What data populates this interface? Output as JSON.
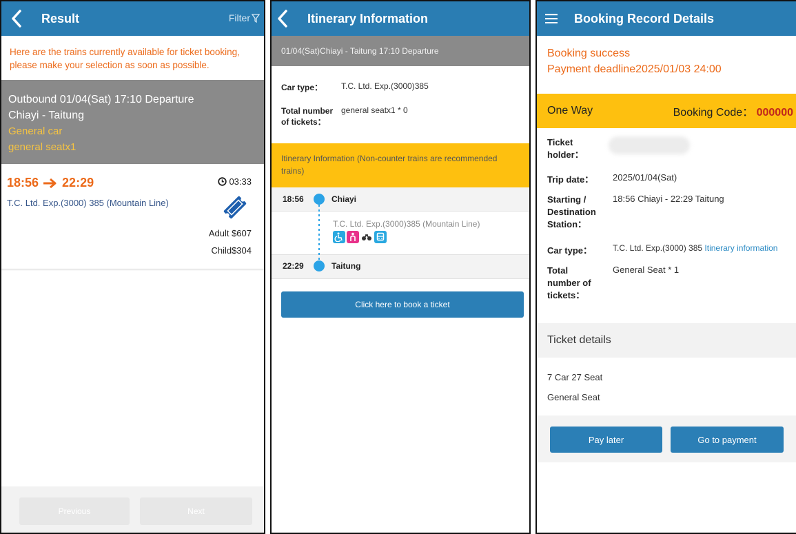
{
  "p1": {
    "title": "Result",
    "filter": "Filter",
    "notice": "Here are the trains currently available for ticket booking, please make your selection as soon as possible.",
    "outbound": "Outbound 01/04(Sat) 17:10 Departure",
    "route": "Chiayi - Taitung",
    "car": "General car",
    "seat": "general seatx1",
    "depart": "18:56",
    "arrive": "22:29",
    "duration": "03:33",
    "train": "T.C. Ltd. Exp.(3000) 385 (Mountain Line)",
    "adult": "Adult $607",
    "child": "Child$304",
    "prev": "Previous",
    "next": "Next"
  },
  "p2": {
    "title": "Itinerary Information",
    "subheader": "01/04(Sat)Chiayi - Taitung 17:10 Departure",
    "car_type_label": "Car type：",
    "car_type_value": "T.C. Ltd. Exp.(3000)385",
    "tickets_label": "Total number of tickets：",
    "tickets_value": "general seatx1 * 0",
    "banner": "Itinerary Information (Non-counter trains are recommended trains)",
    "stop1_time": "18:56",
    "stop1_name": "Chiayi",
    "train_desc": "T.C. Ltd. Exp.(3000)385 (Mountain Line)",
    "stop2_time": "22:29",
    "stop2_name": "Taitung",
    "book_btn": "Click here to book a ticket"
  },
  "p3": {
    "title": "Booking Record Details",
    "status": "Booking success",
    "deadline": "Payment deadline2025/01/03 24:00",
    "trip_type": "One Way",
    "code_label": "Booking Code：",
    "code_value": "000000",
    "holder_label": "Ticket holder：",
    "date_label": "Trip date：",
    "date_value": "2025/01/04(Sat)",
    "station_label": "Starting / Destination Station：",
    "station_value": "18:56 Chiayi - 22:29 Taitung",
    "car_label": "Car type：",
    "car_value": "T.C. Ltd. Exp.(3000) 385",
    "itin_link": "Itinerary information",
    "num_label": "Total number of tickets：",
    "num_value": "General Seat * 1",
    "details_header": "Ticket details",
    "seat_pos": "7 Car 27 Seat",
    "seat_type": "General Seat",
    "pay_later": "Pay later",
    "go_pay": "Go to payment"
  },
  "colors": {
    "header_blue": "#2a7db3",
    "orange": "#ec6a1a",
    "yellow": "#fec00f",
    "gold_text": "#f5c342",
    "gray": "#8a8a8a",
    "accent_icon": "#1e5fae",
    "timeline_dot": "#2ba3e6"
  },
  "icons": [
    "back-arrow-icon",
    "filter-icon",
    "arrow-right-icon",
    "clock-icon",
    "ticket-icon",
    "wheelchair-icon",
    "nursing-icon",
    "bicycle-icon",
    "train-icon",
    "menu-icon"
  ]
}
